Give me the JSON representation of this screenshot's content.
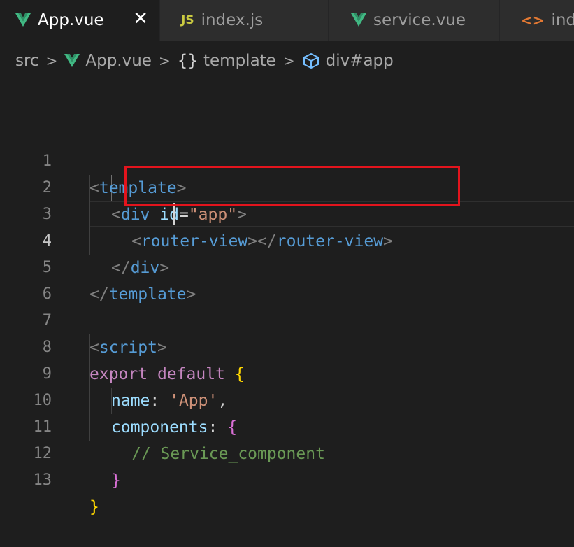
{
  "tabs": [
    {
      "label": "App.vue",
      "icon": "vue-icon",
      "active": true,
      "close": "✕"
    },
    {
      "label": "index.js",
      "icon": "js-icon",
      "active": false
    },
    {
      "label": "service.vue",
      "icon": "vue-icon",
      "active": false
    },
    {
      "label": "inde",
      "icon": "html-icon",
      "active": false
    }
  ],
  "icons": {
    "js_label": "JS",
    "html_label": "<>"
  },
  "breadcrumb": {
    "items": [
      "src",
      "App.vue",
      "template",
      "div#app"
    ],
    "braces": "{}",
    "separator": ">"
  },
  "editor": {
    "current_line": 4,
    "lines": [
      {
        "n": "1"
      },
      {
        "n": "2"
      },
      {
        "n": "3"
      },
      {
        "n": "4"
      },
      {
        "n": "5"
      },
      {
        "n": "6"
      },
      {
        "n": "7"
      },
      {
        "n": "8"
      },
      {
        "n": "9"
      },
      {
        "n": "10"
      },
      {
        "n": "11"
      },
      {
        "n": "12"
      },
      {
        "n": "13"
      }
    ],
    "tokens": {
      "lt": "<",
      "gt": ">",
      "lts": "</",
      "eq": "=",
      "template": "template",
      "div": "div",
      "id": "id",
      "app_str": "\"app\"",
      "router_view": "router-view",
      "script": "script",
      "export": "export",
      "default": "default",
      "brace_open": "{",
      "brace_close": "}",
      "name": "name",
      "colon": ":",
      "app_name": "'App'",
      "comma": ",",
      "components": "components",
      "comment": "// Service_component"
    }
  },
  "colors": {
    "highlight_box": "#e3141d",
    "vue_green": "#41b883",
    "js_yellow": "#cbcb41"
  }
}
